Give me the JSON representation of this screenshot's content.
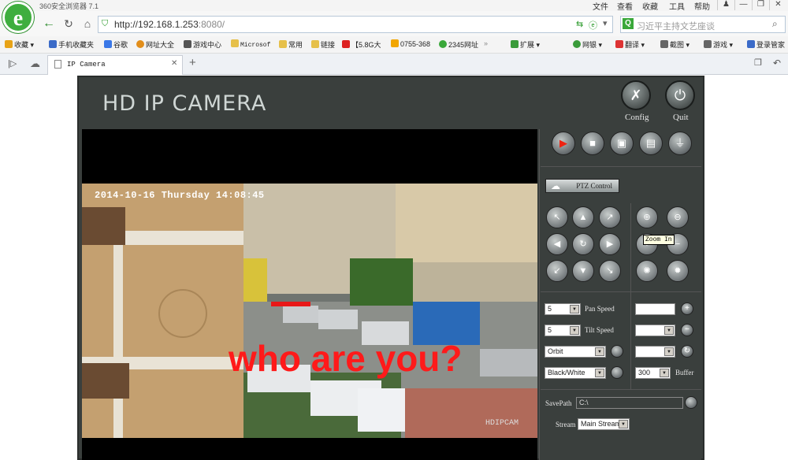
{
  "browser": {
    "title": "360安全浏览器 7.1",
    "menu": [
      "文件",
      "查看",
      "收藏",
      "工具",
      "帮助"
    ],
    "address_host": "http://192.168.1.253",
    "address_port": ":8080/",
    "search_placeholder": "习近平主持文艺座谈",
    "tab_title": "IP Camera",
    "bookmarks": [
      {
        "label": "收藏",
        "icon": "star-icon",
        "color": "#e8a317"
      },
      {
        "label": "手机收藏夹",
        "icon": "phone-icon",
        "color": "#3b6bc8"
      },
      {
        "label": "谷歌",
        "icon": "google-icon",
        "color": "#3b78e7"
      },
      {
        "label": "网址大全",
        "icon": "globe-icon",
        "color": "#e28e1a"
      },
      {
        "label": "游戏中心",
        "icon": "gamepad-icon",
        "color": "#555"
      },
      {
        "label": "Microsof",
        "icon": "folder-icon",
        "color": "#e6c04a"
      },
      {
        "label": "常用",
        "icon": "folder-icon",
        "color": "#e6c04a"
      },
      {
        "label": "链接",
        "icon": "folder-icon",
        "color": "#e6c04a"
      },
      {
        "label": "【5.8G大",
        "icon": "site-114-icon",
        "color": "#d22"
      },
      {
        "label": "0755-368",
        "icon": "site-icon",
        "color": "#f2a600"
      },
      {
        "label": "2345网址",
        "icon": "site-2345-icon",
        "color": "#3aa83a"
      }
    ],
    "toolbar_right": [
      {
        "label": "扩展",
        "icon": "puzzle-icon",
        "color": "#3a9b3a"
      },
      {
        "label": "网银",
        "icon": "bank-icon",
        "color": "#3a9b3a"
      },
      {
        "label": "翻译",
        "icon": "translate-icon",
        "color": "#d33"
      },
      {
        "label": "截图",
        "icon": "scissors-icon",
        "color": "#666"
      },
      {
        "label": "游戏",
        "icon": "gamepad-icon",
        "color": "#666"
      },
      {
        "label": "登录管家",
        "icon": "key-icon",
        "color": "#3b6bc8"
      }
    ]
  },
  "app": {
    "title": "HD IP CAMERA",
    "config_label": "Config",
    "quit_label": "Quit",
    "osd_time": "2014-10-16 Thursday 14:08:45",
    "overlay_text": "who are you?",
    "brand": "HDIPCAM",
    "ptz_label": "PTZ Control",
    "tooltip": "Zoom In",
    "pan_speed_label": "Pan Speed",
    "pan_speed_value": "5",
    "tilt_speed_label": "Tilt Speed",
    "tilt_speed_value": "5",
    "orbit_value": "Orbit",
    "color_mode_value": "Black/White",
    "buffer_label": "Buffer",
    "buffer_value": "300",
    "savepath_label": "SavePath",
    "savepath_value": "C:\\",
    "stream_label": "Stream",
    "stream_value": "Main Stream"
  }
}
